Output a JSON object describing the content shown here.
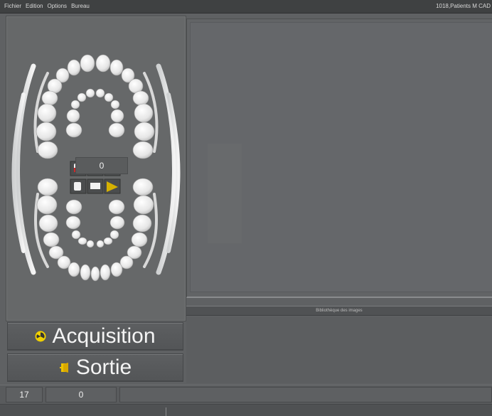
{
  "menubar": {
    "items": [
      "Fichier",
      "Edition",
      "Options",
      "Bureau"
    ],
    "title": "1018,Patients M CAD"
  },
  "dental_chart": {
    "counter": "0"
  },
  "viewer": {
    "library_label": "Bibliothèque des images"
  },
  "buttons": {
    "acquisition": "Acquisition",
    "sortie": "Sortie"
  },
  "statusbar": {
    "cell1": "17",
    "cell2": "0"
  },
  "colors": {
    "acquisition_icon": "#f0d000",
    "sortie_icon": "#f0c400",
    "red_marker": "#d02828"
  }
}
